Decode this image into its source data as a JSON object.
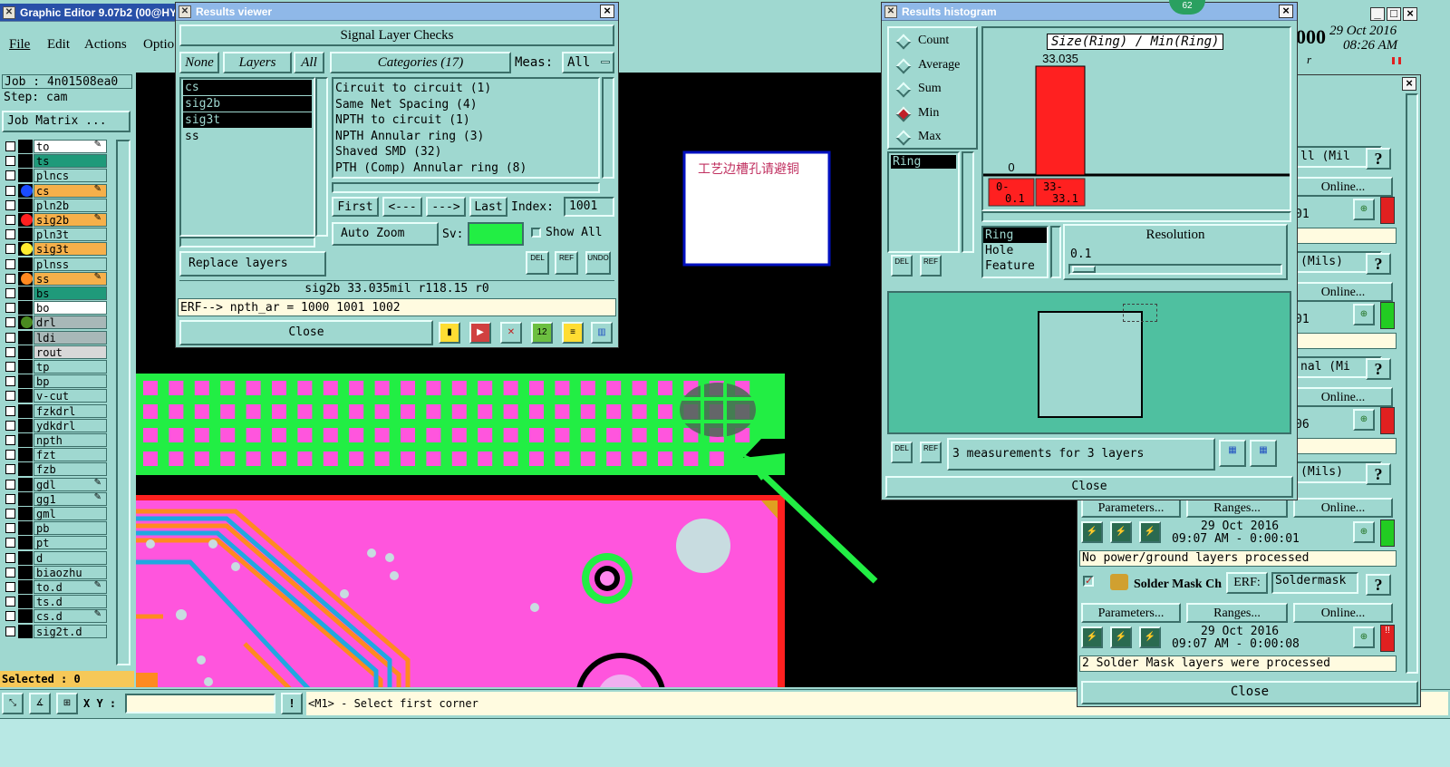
{
  "main": {
    "title": "Graphic Editor 9.07b2 (00@HY-H",
    "menu": [
      "File",
      "Edit",
      "Actions",
      "Optio"
    ],
    "job": "Job : 4n01508ea0",
    "step": "Step: cam",
    "job_matrix": "Job Matrix ...",
    "clock": {
      "date": "29 Oct 2016",
      "time": "08:26 AM",
      "partial": "000",
      "r": "r"
    },
    "selected": "Selected : 0",
    "xy_label": "X Y :",
    "xy_value": "",
    "status_prompt": "<M1> - Select first corner",
    "layers": [
      {
        "name": "to",
        "dot": "",
        "fill": "#ffffff",
        "edit": true
      },
      {
        "name": "ts",
        "dot": "",
        "fill": "#1f9a7a",
        "edit": false
      },
      {
        "name": "plncs",
        "dot": "",
        "fill": "#9fd8d0",
        "edit": false
      },
      {
        "name": "cs",
        "dot": "#1a4cff",
        "fill": "#f6b04a",
        "edit": true
      },
      {
        "name": "pln2b",
        "dot": "",
        "fill": "#9fd8d0",
        "edit": false
      },
      {
        "name": "sig2b",
        "dot": "#ff2020",
        "fill": "#f6b04a",
        "edit": true
      },
      {
        "name": "pln3t",
        "dot": "",
        "fill": "#9fd8d0",
        "edit": false
      },
      {
        "name": "sig3t",
        "dot": "#ffee30",
        "fill": "#f6b04a",
        "edit": false
      },
      {
        "name": "plnss",
        "dot": "",
        "fill": "#9fd8d0",
        "edit": false
      },
      {
        "name": "ss",
        "dot": "#ff8a20",
        "fill": "#f6b04a",
        "edit": true
      },
      {
        "name": "bs",
        "dot": "",
        "fill": "#1f9a7a",
        "edit": false
      },
      {
        "name": "bo",
        "dot": "",
        "fill": "#ffffff",
        "edit": false
      },
      {
        "name": "drl",
        "dot": "#4a8a20",
        "fill": "#a8b8b8",
        "edit": false
      },
      {
        "name": "ldi",
        "dot": "",
        "fill": "#a8b8b8",
        "edit": false
      },
      {
        "name": "rout",
        "dot": "",
        "fill": "#d8d8d8",
        "edit": false
      },
      {
        "name": "tp",
        "dot": "",
        "fill": "#9fd8d0",
        "edit": false
      },
      {
        "name": "bp",
        "dot": "",
        "fill": "#9fd8d0",
        "edit": false
      },
      {
        "name": "v-cut",
        "dot": "",
        "fill": "#9fd8d0",
        "edit": false
      },
      {
        "name": "fzkdrl",
        "dot": "",
        "fill": "#9fd8d0",
        "edit": false
      },
      {
        "name": "ydkdrl",
        "dot": "",
        "fill": "#9fd8d0",
        "edit": false
      },
      {
        "name": "npth",
        "dot": "",
        "fill": "#9fd8d0",
        "edit": false
      },
      {
        "name": "fzt",
        "dot": "",
        "fill": "#9fd8d0",
        "edit": false
      },
      {
        "name": "fzb",
        "dot": "",
        "fill": "#9fd8d0",
        "edit": false
      },
      {
        "name": "gdl",
        "dot": "",
        "fill": "#9fd8d0",
        "edit": true
      },
      {
        "name": "gg1",
        "dot": "",
        "fill": "#9fd8d0",
        "edit": true
      },
      {
        "name": "gml",
        "dot": "",
        "fill": "#9fd8d0",
        "edit": false
      },
      {
        "name": "pb",
        "dot": "",
        "fill": "#9fd8d0",
        "edit": false
      },
      {
        "name": "pt",
        "dot": "",
        "fill": "#9fd8d0",
        "edit": false
      },
      {
        "name": "d",
        "dot": "",
        "fill": "#9fd8d0",
        "edit": false
      },
      {
        "name": "biaozhu",
        "dot": "",
        "fill": "#9fd8d0",
        "edit": false
      },
      {
        "name": "to.d",
        "dot": "",
        "fill": "#9fd8d0",
        "edit": true
      },
      {
        "name": "ts.d",
        "dot": "",
        "fill": "#9fd8d0",
        "edit": false
      },
      {
        "name": "cs.d",
        "dot": "",
        "fill": "#9fd8d0",
        "edit": true
      },
      {
        "name": "sig2t.d",
        "dot": "",
        "fill": "#9fd8d0",
        "edit": false
      }
    ],
    "annotation_text": "工艺边槽孔请避铜"
  },
  "results_viewer": {
    "title": "Results viewer",
    "heading": "Signal Layer Checks",
    "none_btn": "None",
    "layers_btn": "Layers",
    "all_btn": "All",
    "categories_btn": "Categories (17)",
    "meas_label": "Meas:",
    "meas_value": "All",
    "layer_list": [
      "cs",
      "sig2b",
      "sig3t",
      "ss"
    ],
    "categories": [
      "Circuit to circuit (1)",
      "Same Net Spacing (4)",
      "NPTH to circuit (1)",
      "NPTH Annular ring (3)",
      "Shaved SMD (32)",
      "PTH (Comp) Annular ring (8)"
    ],
    "first": "First",
    "prev": "<---",
    "next": "--->",
    "last": "Last",
    "index_label": "Index:",
    "index_value": "1001",
    "auto_zoom": "Auto Zoom",
    "sv_label": "Sv:",
    "show_all": "Show All",
    "replace_layers": "Replace layers",
    "del": "DEL",
    "ref": "REF",
    "undo": "UNDO",
    "info_line": "sig2b 33.035mil  r118.15  r0",
    "erf_line": "ERF--> npth_ar = 1000 1001 1002",
    "close": "Close"
  },
  "histogram": {
    "title": "Results histogram",
    "stats": [
      {
        "label": "Count",
        "on": false
      },
      {
        "label": "Average",
        "on": false
      },
      {
        "label": "Sum",
        "on": false
      },
      {
        "label": "Min",
        "on": true
      },
      {
        "label": "Max",
        "on": false
      }
    ],
    "chart_title": "Size(Ring) / Min(Ring)",
    "measure_list": [
      "Ring"
    ],
    "ring_options": [
      "Ring",
      "Hole",
      "Feature"
    ],
    "resolution_label": "Resolution",
    "resolution_value": "0.1",
    "summary": "3 measurements for 3 layers",
    "del": "DEL",
    "ref": "REF",
    "close": "Close"
  },
  "chart_data": {
    "type": "bar",
    "title": "Size(Ring) / Min(Ring)",
    "categories": [
      "0-0.1",
      "33-33.1"
    ],
    "values": [
      0,
      33.035
    ],
    "value_labels": [
      "0",
      "33.035"
    ],
    "bin_labels": [
      [
        "0-",
        "0.1"
      ],
      [
        "33-",
        "33.1"
      ]
    ],
    "ylim": [
      0,
      33.035
    ],
    "color": "#ff2020"
  },
  "checklist": {
    "badge": "62",
    "rows": [
      {
        "label": "ll (Mil",
        "online": "Online...",
        "value": "01",
        "status": "red"
      },
      {
        "label": "(Mils)",
        "online": "Online...",
        "value": "01",
        "status": "green"
      },
      {
        "label": "nal (Mi",
        "online": "Online...",
        "value": "06",
        "status": "red"
      },
      {
        "label": "(Mils)",
        "online": "Online...",
        "value": "",
        "status": "green"
      }
    ],
    "parameters": "Parameters...",
    "ranges": "Ranges...",
    "online": "Online...",
    "run1_date": "29 Oct 2016",
    "run1_time": "09:07 AM - 0:00:01",
    "run1_msg": "No power/ground layers processed",
    "soldermask_label": "Solder Mask Ch",
    "erf_label": "ERF:",
    "erf_value": "Soldermask",
    "run2_date": "29 Oct 2016",
    "run2_time": "09:07 AM - 0:00:08",
    "run2_msg": "2 Solder Mask layers were processed",
    "help": "?",
    "close": "Close"
  },
  "colors": {
    "panel": "#9fd8d0",
    "board_green": "#22ee44",
    "pad_pink": "#ff55dd",
    "trace_orange": "#ff8a20",
    "trace_blue": "#20a8e0",
    "arrow": "#22ee44"
  }
}
